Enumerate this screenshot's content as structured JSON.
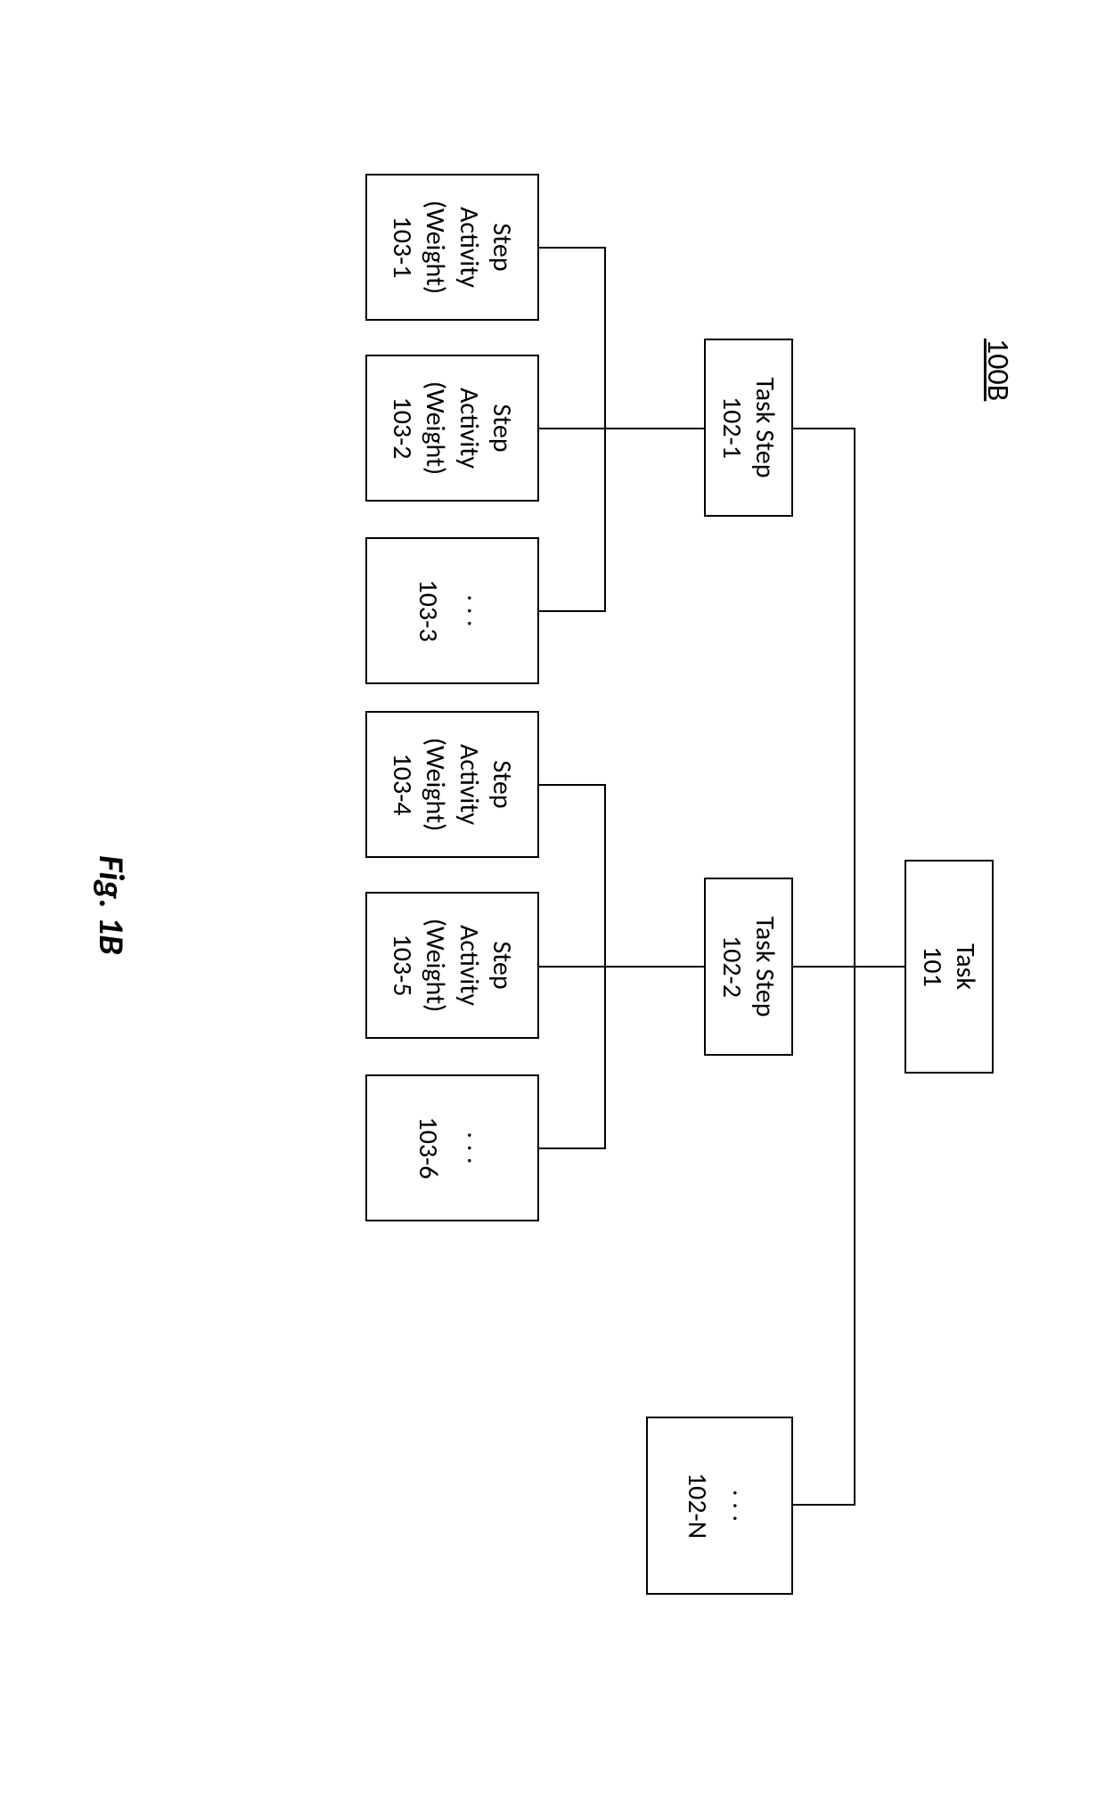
{
  "diagram": {
    "label": "100B",
    "caption": "Fig. 1B",
    "root": {
      "title": "Task",
      "ref": "101"
    },
    "steps": [
      {
        "title": "Task Step",
        "ref": "102-1"
      },
      {
        "title": "Task Step",
        "ref": "102-2"
      },
      {
        "ellipsis": ". . .",
        "ref": "102-N"
      }
    ],
    "activities": [
      {
        "title": "Step Activity (Weight)",
        "ref": "103-1"
      },
      {
        "title": "Step Activity (Weight)",
        "ref": "103-2"
      },
      {
        "ellipsis": ". . .",
        "ref": "103-3"
      },
      {
        "title": "Step Activity (Weight)",
        "ref": "103-4"
      },
      {
        "title": "Step Activity (Weight)",
        "ref": "103-5"
      },
      {
        "ellipsis": ". . .",
        "ref": "103-6"
      }
    ]
  }
}
